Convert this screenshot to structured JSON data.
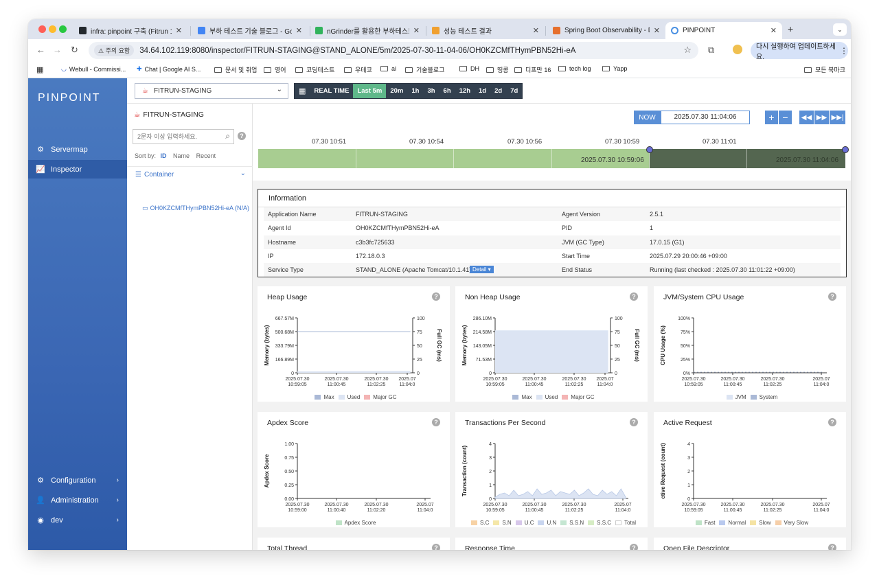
{
  "browser": {
    "tabs": [
      {
        "title": "infra: pinpoint 구축 (Fitrun 18",
        "icon_color": "#24292e"
      },
      {
        "title": "부하 테스트 기술 블로그 - Google",
        "icon_color": "#4285f4"
      },
      {
        "title": "nGrinder를 활용한 부하테스트 | ",
        "icon_color": "#31b35c"
      },
      {
        "title": "성능 테스트 결과",
        "icon_color": "#f0a030"
      },
      {
        "title": "Spring Boot Observability - D",
        "icon_color": "#e6702e"
      },
      {
        "title": "PINPOINT",
        "icon_color": "#4a90e2"
      }
    ],
    "new_tab": "+",
    "security_label": "주의 요함",
    "url": "34.64.102.119:8080/inspector/FITRUN-STAGING@STAND_ALONE/5m/2025-07-30-11-04-06/OH0KZCMfTHymPBN52Hi-eA",
    "update_button": "다시 실행하여 업데이트하세요.",
    "bookmarks": [
      "Webull - Commissi...",
      "Chat | Google AI S...",
      "문서 및 취업",
      "영어",
      "코딩테스트",
      "우테코",
      "ai",
      "기술블로그",
      "DH",
      "띵콩",
      "디프만 16",
      "tech log",
      "Yapp"
    ],
    "all_bookmarks": "모든 북마크"
  },
  "sidebar": {
    "logo": "PINPOINT",
    "items": [
      {
        "label": "Servermap",
        "icon": "servermap-icon"
      },
      {
        "label": "Inspector",
        "icon": "inspector-icon"
      }
    ],
    "bottom": [
      {
        "label": "Configuration",
        "icon": "gear-icon"
      },
      {
        "label": "Administration",
        "icon": "admin-icon"
      },
      {
        "label": "dev",
        "icon": "user-icon"
      }
    ]
  },
  "toolbar": {
    "application": "FITRUN-STAGING",
    "ranges": [
      "REAL TIME",
      "Last 5m",
      "20m",
      "1h",
      "3h",
      "6h",
      "12h",
      "1d",
      "2d",
      "7d"
    ],
    "active_range": "Last 5m"
  },
  "agent_panel": {
    "app_name": "FITRUN-STAGING",
    "search_placeholder": "2문자 이상 입력하세요.",
    "sort_label": "Sort by:",
    "sort_options": [
      "ID",
      "Name",
      "Recent"
    ],
    "group": "Container",
    "agent": "OH0KZCMfTHymPBN52Hi-eA (N/A)"
  },
  "timeline": {
    "now_label": "NOW",
    "now_value": "2025.07.30 11:04:06",
    "ticks": [
      "07.30 10:51",
      "07.30 10:54",
      "07.30 10:56",
      "07.30 10:59",
      "07.30 11:01"
    ],
    "selected_start": "2025.07.30 10:59:06",
    "selected_end": "2025.07.30 11:04:06"
  },
  "information": {
    "title": "Information",
    "rows": [
      {
        "k1": "Application Name",
        "v1": "FITRUN-STAGING",
        "k2": "Agent Version",
        "v2": "2.5.1"
      },
      {
        "k1": "Agent Id",
        "v1": "OH0KZCMfTHymPBN52Hi-eA",
        "k2": "PID",
        "v2": "1"
      },
      {
        "k1": "Hostname",
        "v1": "c3b3fc725633",
        "k2": "JVM (GC Type)",
        "v2": "17.0.15 (G1)"
      },
      {
        "k1": "IP",
        "v1": "172.18.0.3",
        "k2": "Start Time",
        "v2": "2025.07.29 20:00:46 +09:00"
      },
      {
        "k1": "Service Type",
        "v1": "STAND_ALONE (Apache Tomcat/10.1.41)",
        "k2": "End Status",
        "v2": "Running (last checked : 2025.07.30 11:01:22 +09:00)"
      }
    ],
    "detail_button": "Detail ▾"
  },
  "cards": [
    {
      "title": "Heap Usage",
      "ylabel": "Memory (bytes)",
      "y2label": "Full GC (ms)",
      "yticks": [
        "667.57M",
        "500.68M",
        "333.79M",
        "166.89M",
        "0"
      ],
      "y2ticks": [
        "100",
        "75",
        "50",
        "25",
        "0"
      ],
      "xticks": [
        "2025.07.30\n10:59:05",
        "2025.07.30\n11:00:45",
        "2025.07.30\n11:02:25",
        "2025.07\n11:04:0"
      ],
      "legend": [
        {
          "name": "Max",
          "color": "#aab9d6"
        },
        {
          "name": "Used",
          "color": "#dce4f3"
        },
        {
          "name": "Major GC",
          "color": "#f4b4b4"
        }
      ]
    },
    {
      "title": "Non Heap Usage",
      "ylabel": "Memory (bytes)",
      "y2label": "Full GC (ms)",
      "yticks": [
        "286.10M",
        "214.58M",
        "143.05M",
        "71.53M",
        "0"
      ],
      "y2ticks": [
        "100",
        "75",
        "50",
        "25",
        "0"
      ],
      "xticks": [
        "2025.07.30\n10:59:05",
        "2025.07.30\n11:00:45",
        "2025.07.30\n11:02:25",
        "2025.07\n11:04:0"
      ],
      "legend": [
        {
          "name": "Max",
          "color": "#aab9d6"
        },
        {
          "name": "Used",
          "color": "#dce4f3"
        },
        {
          "name": "Major GC",
          "color": "#f4b4b4"
        }
      ]
    },
    {
      "title": "JVM/System CPU Usage",
      "ylabel": "CPU Usage (%)",
      "y2label": "",
      "yticks": [
        "100%",
        "75%",
        "50%",
        "25%",
        "0%"
      ],
      "y2ticks": [],
      "xticks": [
        "2025.07.30\n10:59:05",
        "2025.07.30\n11:00:45",
        "2025.07.30\n11:02:25",
        "2025.07\n11:04:0"
      ],
      "legend": [
        {
          "name": "JVM",
          "color": "#dce4f3"
        },
        {
          "name": "System",
          "color": "#aab9d6"
        }
      ]
    },
    {
      "title": "Apdex Score",
      "ylabel": "Apdex Score",
      "y2label": "",
      "yticks": [
        "1.00",
        "0.75",
        "0.50",
        "0.25",
        "0.00"
      ],
      "y2ticks": [],
      "xticks": [
        "2025.07.30\n10:59:00",
        "2025.07.30\n11:00:40",
        "2025.07.30\n11:02:20",
        "2025.07\n11:04:0"
      ],
      "legend": [
        {
          "name": "Apdex Score",
          "color": "#bfe3c7"
        }
      ]
    },
    {
      "title": "Transactions Per Second",
      "ylabel": "Transaction (count)",
      "y2label": "",
      "yticks": [
        "4",
        "3",
        "2",
        "1",
        "0"
      ],
      "y2ticks": [],
      "xticks": [
        "2025.07.30\n10:59:05",
        "2025.07.30\n11:00:45",
        "2025.07.30\n11:02:25",
        "2025.07\n11:04:0"
      ],
      "legend": [
        {
          "name": "S.C",
          "color": "#f7d2a5"
        },
        {
          "name": "S.N",
          "color": "#f5e7a8"
        },
        {
          "name": "U.C",
          "color": "#d7c7ea"
        },
        {
          "name": "U.N",
          "color": "#c8d5ef"
        },
        {
          "name": "S.S.N",
          "color": "#c5e6d2"
        },
        {
          "name": "S.S.C",
          "color": "#d6ecc4"
        },
        {
          "name": "Total",
          "color": "#ffffff"
        }
      ]
    },
    {
      "title": "Active Request",
      "ylabel": "ctive Request (count)",
      "y2label": "",
      "yticks": [
        "4",
        "3",
        "2",
        "1",
        "0"
      ],
      "y2ticks": [],
      "xticks": [
        "2025.07.30\n10:59:05",
        "2025.07.30\n11:00:45",
        "2025.07.30\n11:02:25",
        "2025.07\n11:04:0"
      ],
      "legend": [
        {
          "name": "Fast",
          "color": "#bfe3c7"
        },
        {
          "name": "Normal",
          "color": "#b9c9ee"
        },
        {
          "name": "Slow",
          "color": "#f5e3a4"
        },
        {
          "name": "Very Slow",
          "color": "#f6cfa9"
        }
      ]
    },
    {
      "title": "Total Thread",
      "ylabel": "",
      "y2label": "",
      "yticks": [],
      "y2ticks": [],
      "xticks": [],
      "legend": []
    },
    {
      "title": "Response Time",
      "ylabel": "",
      "y2label": "",
      "yticks": [],
      "y2ticks": [],
      "xticks": [],
      "legend": []
    },
    {
      "title": "Open File Descriptor",
      "ylabel": "",
      "y2label": "",
      "yticks": [],
      "y2ticks": [],
      "xticks": [],
      "legend": []
    }
  ],
  "chart_data": [
    {
      "type": "area",
      "title": "Heap Usage",
      "ylim_mb": [
        0,
        667.57
      ],
      "series": [
        {
          "name": "Max",
          "values": [
            500.68,
            500.68
          ]
        },
        {
          "name": "Used",
          "values": [
            83,
            116
          ]
        }
      ]
    },
    {
      "type": "area",
      "title": "Non Heap Usage",
      "ylim_mb": [
        0,
        286.1
      ],
      "series": [
        {
          "name": "Max",
          "values": [
            0,
            0
          ]
        },
        {
          "name": "Used",
          "values": [
            221,
            221
          ]
        }
      ]
    },
    {
      "type": "line",
      "title": "JVM/System CPU Usage",
      "ylim": [
        0,
        100
      ],
      "series": [
        {
          "name": "JVM",
          "values": [
            1,
            1
          ]
        },
        {
          "name": "System",
          "values": [
            1,
            1
          ]
        }
      ]
    },
    {
      "type": "line",
      "title": "Transactions Per Second",
      "ylim": [
        0,
        4
      ],
      "series": [
        {
          "name": "Total",
          "values": [
            0.1,
            0.3,
            0.4,
            0.2,
            0.6,
            0.2,
            0.3,
            0.5,
            0.2,
            0.7,
            0.3,
            0.4,
            0.6,
            0.2,
            0.5,
            0.4,
            0.3,
            0.6,
            0.2,
            0.4,
            0.7,
            0.3,
            0.2,
            0.6,
            0.3,
            0.5,
            0.2,
            0.7,
            0.1
          ]
        }
      ]
    }
  ]
}
